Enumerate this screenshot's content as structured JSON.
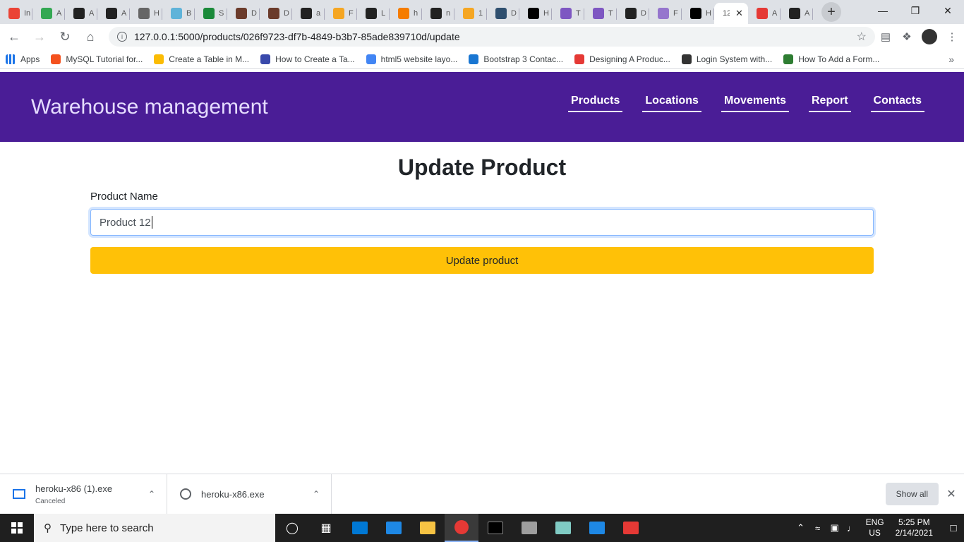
{
  "browser": {
    "tabs": [
      {
        "label": "In",
        "color": "#ea4335"
      },
      {
        "label": "A",
        "color": "#34a853"
      },
      {
        "label": "A",
        "color": "#222"
      },
      {
        "label": "A",
        "color": "#222"
      },
      {
        "label": "H",
        "color": "#666"
      },
      {
        "label": "B",
        "color": "#5fb3d9"
      },
      {
        "label": "S",
        "color": "#1b8a3a"
      },
      {
        "label": "D",
        "color": "#6b3b2b"
      },
      {
        "label": "D",
        "color": "#6b3b2b"
      },
      {
        "label": "a",
        "color": "#222"
      },
      {
        "label": "F",
        "color": "#f5a623"
      },
      {
        "label": "L",
        "color": "#222"
      },
      {
        "label": "h",
        "color": "#f57c00"
      },
      {
        "label": "n",
        "color": "#222"
      },
      {
        "label": "1",
        "color": "#f5a623"
      },
      {
        "label": "D",
        "color": "#2f4f6f"
      },
      {
        "label": "H",
        "color": "#000"
      },
      {
        "label": "T",
        "color": "#7e57c2"
      },
      {
        "label": "T",
        "color": "#7e57c2"
      },
      {
        "label": "D",
        "color": "#222"
      },
      {
        "label": "F",
        "color": "#9575cd"
      },
      {
        "label": "H",
        "color": "#000"
      },
      {
        "label": "12",
        "color": "#ffffff",
        "active": true
      },
      {
        "label": "A",
        "color": "#e53935"
      },
      {
        "label": "A",
        "color": "#222"
      }
    ],
    "url": "127.0.0.1:5000/products/026f9723-df7b-4849-b3b7-85ade839710d/update",
    "bookmarks": [
      {
        "label": "Apps",
        "color": "#1a73e8"
      },
      {
        "label": "MySQL Tutorial for...",
        "color": "#f4511e"
      },
      {
        "label": "Create a Table in M...",
        "color": "#fbbc04"
      },
      {
        "label": "How to Create a Ta...",
        "color": "#3949ab"
      },
      {
        "label": "html5 website layo...",
        "color": "#4285f4"
      },
      {
        "label": "Bootstrap 3 Contac...",
        "color": "#1976d2"
      },
      {
        "label": "Designing A Produc...",
        "color": "#e53935"
      },
      {
        "label": "Login System with...",
        "color": "#333"
      },
      {
        "label": "How To Add a Form...",
        "color": "#2e7d32"
      }
    ]
  },
  "app": {
    "brand": "Warehouse management",
    "nav": [
      "Products",
      "Locations",
      "Movements",
      "Report",
      "Contacts"
    ],
    "heading": "Update Product",
    "form": {
      "label": "Product Name",
      "value": "Product 12",
      "submit": "Update product"
    }
  },
  "downloads": {
    "items": [
      {
        "name": "heroku-x86 (1).exe",
        "status": "Canceled"
      },
      {
        "name": "heroku-x86.exe",
        "status": ""
      }
    ],
    "show_all": "Show all"
  },
  "taskbar": {
    "search_placeholder": "Type here to search",
    "lang_line1": "ENG",
    "lang_line2": "US",
    "time": "5:25 PM",
    "date": "2/14/2021"
  },
  "colors": {
    "navbar": "#4a1d96",
    "button": "#ffc107"
  }
}
